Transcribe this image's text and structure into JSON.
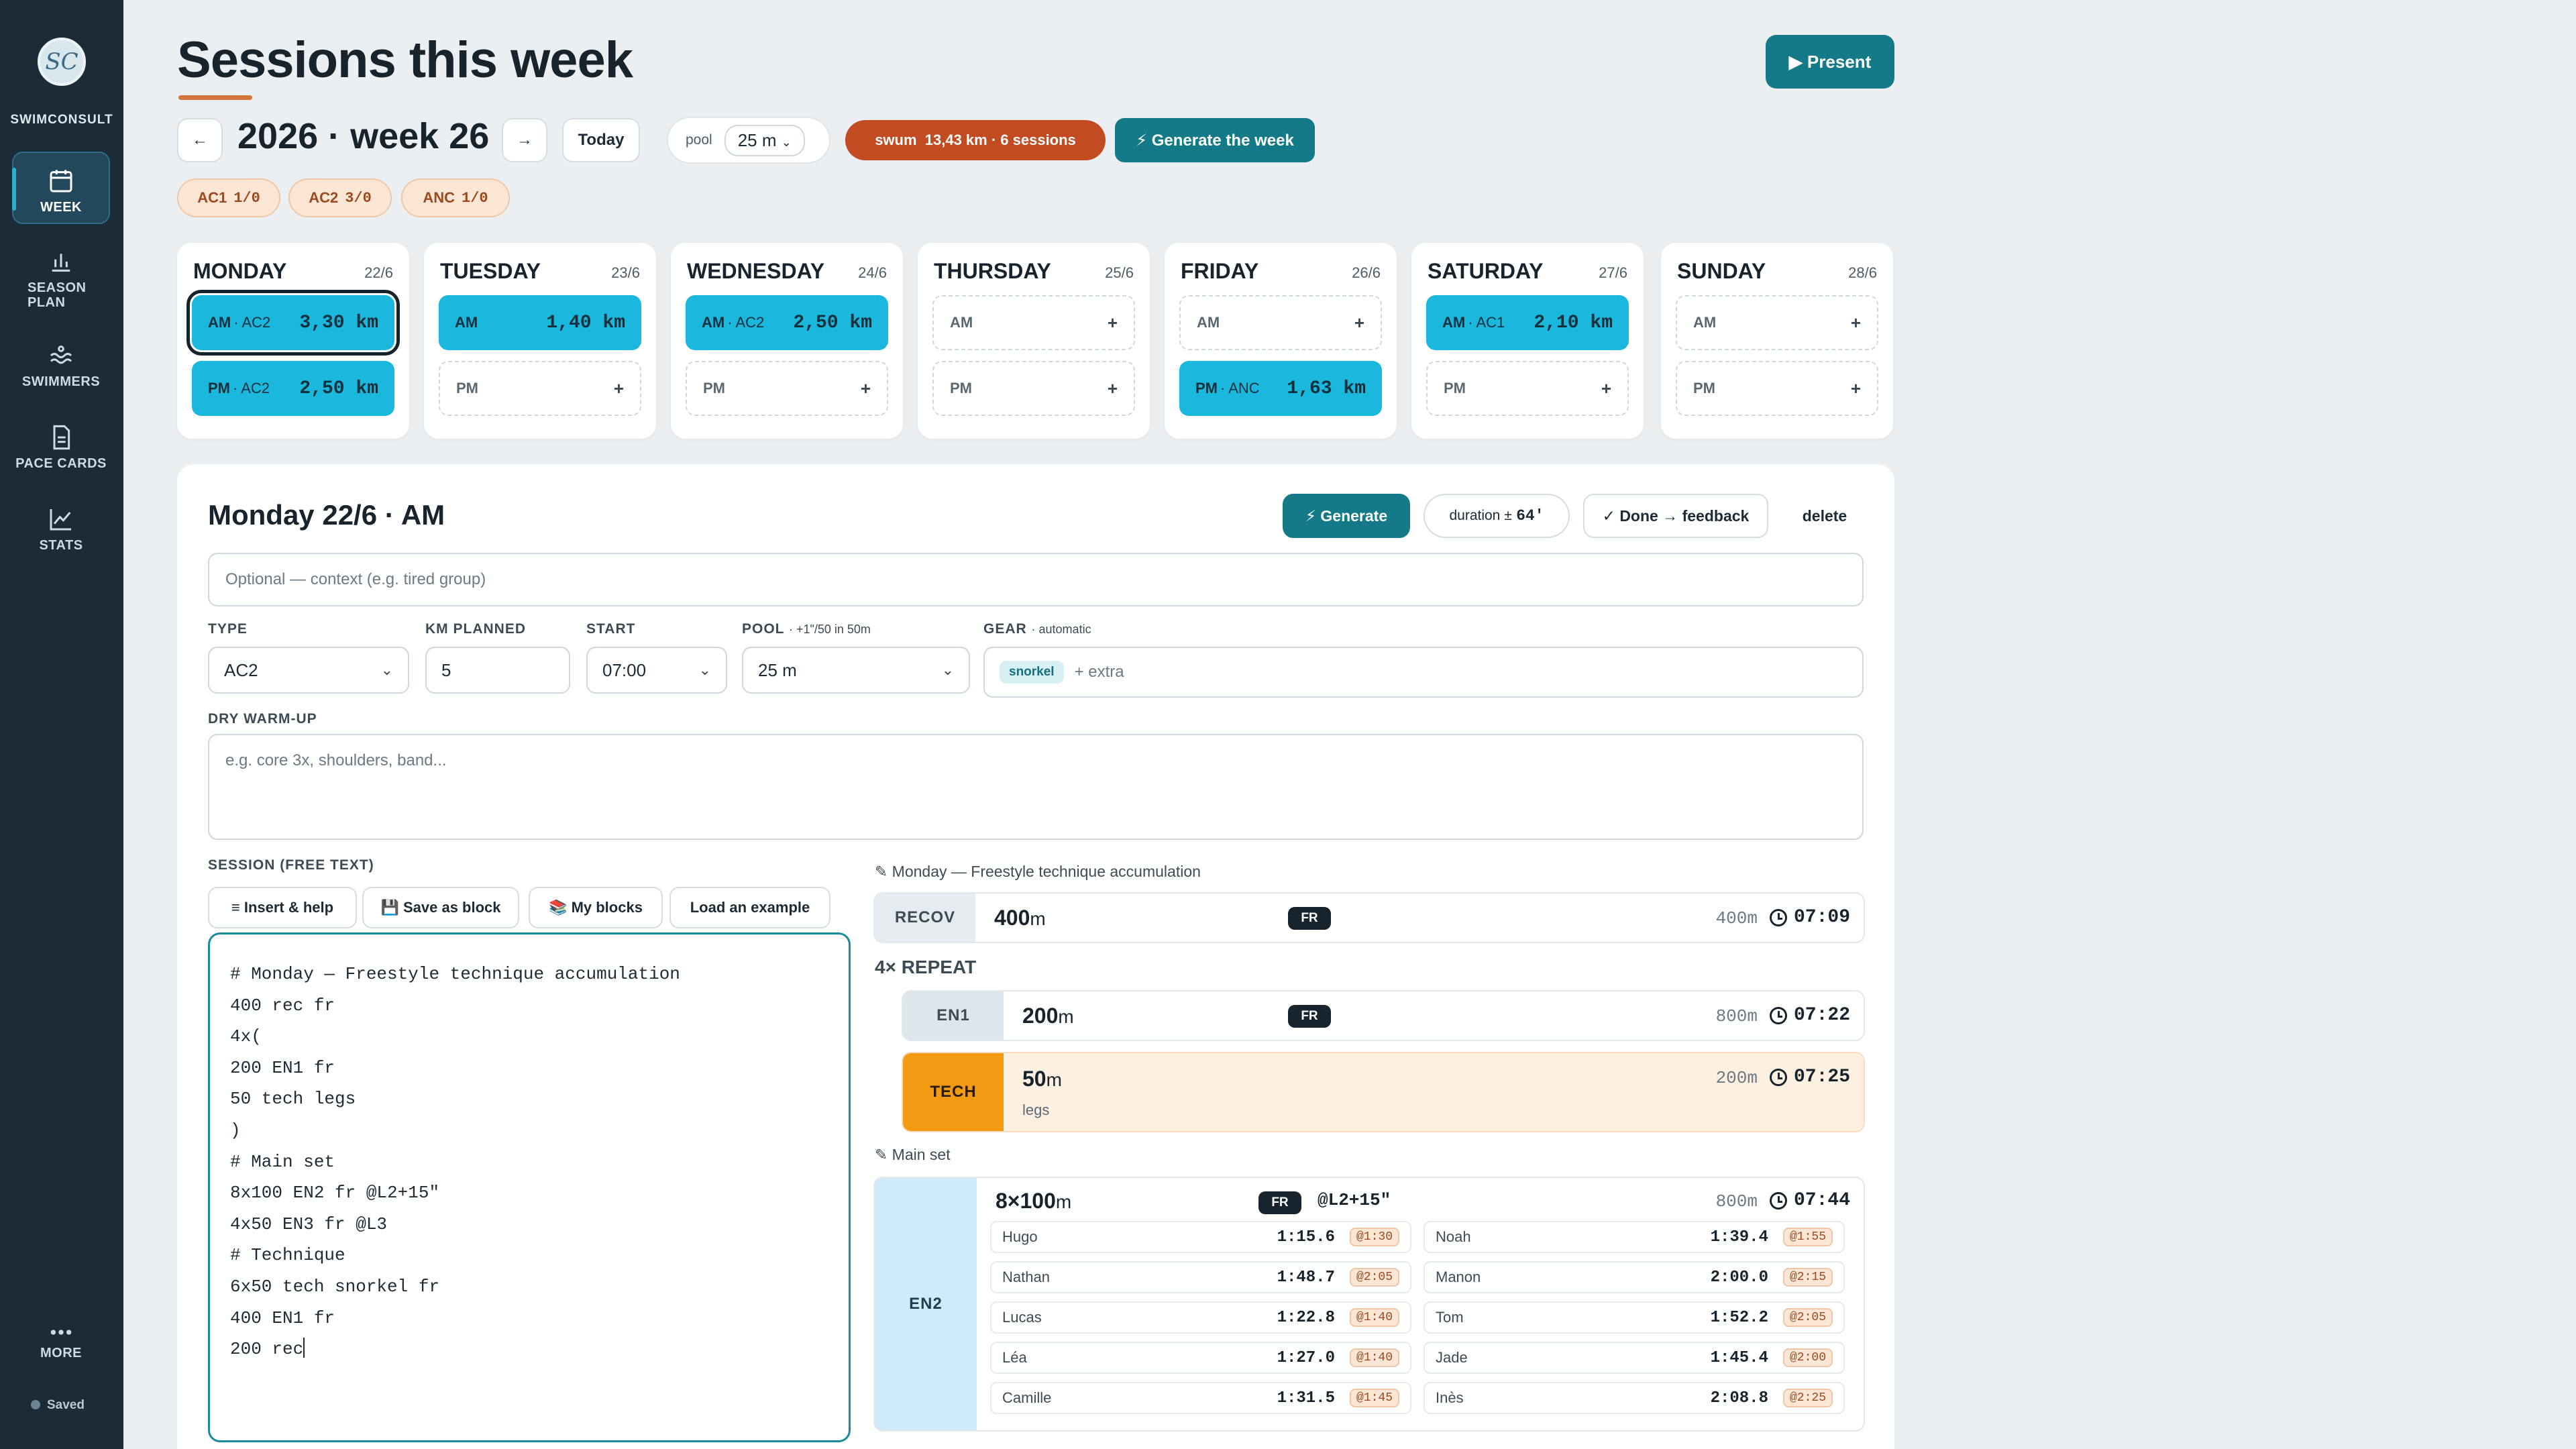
{
  "app": {
    "brand": "SWIMCONSULT",
    "logo_text": "SC"
  },
  "nav": [
    {
      "label": "WEEK",
      "icon": "calendar-icon",
      "active": true
    },
    {
      "label": "SEASON PLAN",
      "icon": "bar-chart-icon"
    },
    {
      "label": "SWIMMERS",
      "icon": "waves-icon"
    },
    {
      "label": "PACE CARDS",
      "icon": "document-icon"
    },
    {
      "label": "STATS",
      "icon": "line-chart-icon"
    },
    {
      "label": "MORE",
      "icon": "more-dots-icon"
    }
  ],
  "status": {
    "saved": "Saved"
  },
  "header": {
    "title": "Sessions this week",
    "present": "▶ Present",
    "prev": "←",
    "next": "→",
    "week_label": "2026 · week 26",
    "today": "Today",
    "pool_label": "pool",
    "pool_value": "25 m",
    "swum": "swum  13,43 km · 6 sessions",
    "generate_week": "⚡ Generate the week"
  },
  "chips": [
    {
      "zone": "AC1",
      "count": "1/0"
    },
    {
      "zone": "AC2",
      "count": "3/0"
    },
    {
      "zone": "ANC",
      "count": "1/0"
    }
  ],
  "days": [
    {
      "name": "MONDAY",
      "date": "22/6",
      "am": {
        "label": "AM",
        "tag": "· AC2",
        "km": "3,30 km",
        "selected": true
      },
      "pm": {
        "label": "PM",
        "tag": "· AC2",
        "km": "2,50 km"
      }
    },
    {
      "name": "TUESDAY",
      "date": "23/6",
      "am": {
        "label": "AM",
        "tag": "",
        "km": "1,40 km"
      },
      "pm": {
        "label": "PM",
        "empty": "+"
      }
    },
    {
      "name": "WEDNESDAY",
      "date": "24/6",
      "am": {
        "label": "AM",
        "tag": "· AC2",
        "km": "2,50 km"
      },
      "pm": {
        "label": "PM",
        "empty": "+"
      }
    },
    {
      "name": "THURSDAY",
      "date": "25/6",
      "am": {
        "label": "AM",
        "empty": "+"
      },
      "pm": {
        "label": "PM",
        "empty": "+"
      }
    },
    {
      "name": "FRIDAY",
      "date": "26/6",
      "am": {
        "label": "AM",
        "empty": "+"
      },
      "pm": {
        "label": "PM",
        "tag": "· ANC",
        "km": "1,63 km"
      }
    },
    {
      "name": "SATURDAY",
      "date": "27/6",
      "am": {
        "label": "AM",
        "tag": "· AC1",
        "km": "2,10 km"
      },
      "pm": {
        "label": "PM",
        "empty": "+"
      }
    },
    {
      "name": "SUNDAY",
      "date": "28/6",
      "am": {
        "label": "AM",
        "empty": "+"
      },
      "pm": {
        "label": "PM",
        "empty": "+"
      }
    }
  ],
  "editor": {
    "title": "Monday 22/6 · AM",
    "generate": "⚡ Generate",
    "duration_label": "duration ±",
    "duration_value": "64′",
    "done": "✓ Done → feedback",
    "delete": "delete",
    "context_placeholder": "Optional — context (e.g. tired group)",
    "type_label": "TYPE",
    "type_value": "AC2",
    "km_label": "KM PLANNED",
    "km_value": "5",
    "start_label": "START",
    "start_value": "07:00",
    "pool_label": "POOL",
    "pool_hint": "· +1\"/50 in 50m",
    "pool_value": "25 m",
    "gear_label": "GEAR",
    "gear_hint": "· automatic",
    "gear_tag": "snorkel",
    "gear_extra": "+ extra",
    "dry_label": "DRY WARM-UP",
    "dry_placeholder": "e.g. core 3x, shoulders, band...",
    "session_label": "SESSION (FREE TEXT)",
    "insert": "≡ Insert & help",
    "save_block": "💾 Save as block",
    "my_blocks": "📚 My blocks",
    "load_example": "Load an example",
    "text": "# Monday — Freestyle technique accumulation\n400 rec fr\n4x(\n200 EN1 fr\n50 tech legs\n)\n# Main set\n8x100 EN2 fr @L2+15\"\n4x50 EN3 fr @L3\n# Technique\n6x50 tech snorkel fr\n400 EN1 fr\n200 rec"
  },
  "preview": {
    "title1": "✎ Monday — Freestyle technique accumulation",
    "recov": {
      "zone": "RECOV",
      "dist": "400",
      "unit": "m",
      "stroke": "FR",
      "total": "400m",
      "time": "07:09"
    },
    "repeat": "4× REPEAT",
    "en1": {
      "zone": "EN1",
      "dist": "200",
      "unit": "m",
      "stroke": "FR",
      "total": "800m",
      "time": "07:22"
    },
    "tech": {
      "zone": "TECH",
      "dist": "50",
      "unit": "m",
      "sub": "legs",
      "total": "200m",
      "time": "07:25"
    },
    "title2": "✎ Main set",
    "en2": {
      "zone": "EN2",
      "dist": "8×100",
      "unit": "m",
      "stroke": "FR",
      "interval": "@L2+15\"",
      "total": "800m",
      "time": "07:44"
    },
    "paces": [
      {
        "name": "Hugo",
        "time": "1:15.6",
        "iv": "@1:30"
      },
      {
        "name": "Noah",
        "time": "1:39.4",
        "iv": "@1:55"
      },
      {
        "name": "Nathan",
        "time": "1:48.7",
        "iv": "@2:05"
      },
      {
        "name": "Manon",
        "time": "2:00.0",
        "iv": "@2:15"
      },
      {
        "name": "Lucas",
        "time": "1:22.8",
        "iv": "@1:40"
      },
      {
        "name": "Tom",
        "time": "1:52.2",
        "iv": "@2:05"
      },
      {
        "name": "Léa",
        "time": "1:27.0",
        "iv": "@1:40"
      },
      {
        "name": "Jade",
        "time": "1:45.4",
        "iv": "@2:00"
      },
      {
        "name": "Camille",
        "time": "1:31.5",
        "iv": "@1:45"
      },
      {
        "name": "Inès",
        "time": "2:08.8",
        "iv": "@2:25"
      }
    ]
  },
  "colors": {
    "accent": "#157a88",
    "slot": "#1ab8dd",
    "swum": "#c24b22",
    "sidebar": "#1b2b38"
  }
}
